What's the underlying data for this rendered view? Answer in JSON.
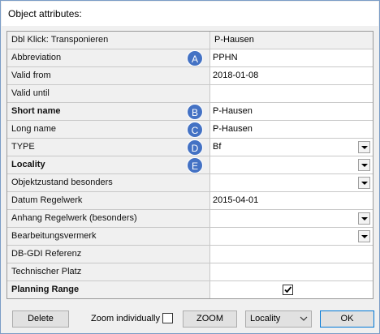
{
  "window": {
    "title": "Object attributes:"
  },
  "grid": {
    "header": {
      "label": "Dbl Klick: Transponieren",
      "value": "P-Hausen"
    },
    "rows": [
      {
        "label": "Abbreviation",
        "value": "PPHN",
        "badge": "A",
        "bold": false,
        "dropdown": false
      },
      {
        "label": "Valid from",
        "value": "2018-01-08",
        "badge": "",
        "bold": false,
        "dropdown": false
      },
      {
        "label": "Valid until",
        "value": "",
        "badge": "",
        "bold": false,
        "dropdown": false
      },
      {
        "label": "Short name",
        "value": "P-Hausen",
        "badge": "B",
        "bold": true,
        "dropdown": false
      },
      {
        "label": "Long name",
        "value": "P-Hausen",
        "badge": "C",
        "bold": false,
        "dropdown": false
      },
      {
        "label": "TYPE",
        "value": "Bf",
        "badge": "D",
        "bold": false,
        "dropdown": true
      },
      {
        "label": "Locality",
        "value": "",
        "badge": "E",
        "bold": true,
        "dropdown": true
      },
      {
        "label": "Objektzustand besonders",
        "value": "",
        "badge": "",
        "bold": false,
        "dropdown": true
      },
      {
        "label": "Datum Regelwerk",
        "value": "2015-04-01",
        "badge": "",
        "bold": false,
        "dropdown": false
      },
      {
        "label": "Anhang Regelwerk (besonders)",
        "value": "",
        "badge": "",
        "bold": false,
        "dropdown": true
      },
      {
        "label": "Bearbeitungsvermerk",
        "value": "",
        "badge": "",
        "bold": false,
        "dropdown": true
      },
      {
        "label": "DB-GDI Referenz",
        "value": "",
        "badge": "",
        "bold": false,
        "dropdown": false
      },
      {
        "label": "Technischer Platz",
        "value": "",
        "badge": "",
        "bold": false,
        "dropdown": false
      }
    ],
    "planning_range": {
      "label": "Planning Range",
      "checked": true
    }
  },
  "footer": {
    "delete_label": "Delete",
    "zoom_individually_label": "Zoom individually",
    "zoom_individually_checked": false,
    "zoom_label": "ZOOM",
    "locality_select_value": "Locality",
    "ok_label": "OK"
  },
  "colors": {
    "badge": "#4472c4",
    "ok_border": "#0078d7"
  }
}
